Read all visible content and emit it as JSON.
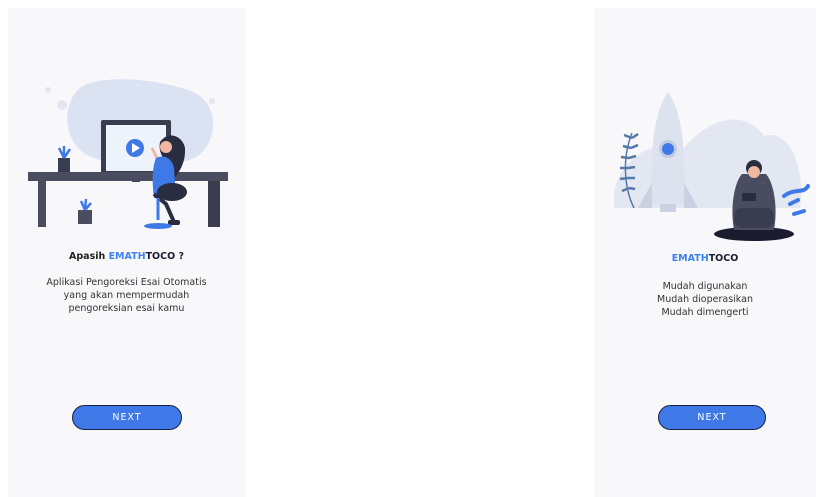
{
  "onboarding_1": {
    "title_prefix": "Apasih",
    "brand_part1": "EMATH",
    "brand_part2": "TOCO",
    "title_suffix": "?",
    "description": [
      "Aplikasi Pengoreksi Esai Otomatis",
      "yang akan mempermudah",
      "pengoreksian esai kamu"
    ],
    "next_label": "NEXT"
  },
  "onboarding_2": {
    "brand_part1": "EMATH",
    "brand_part2": "TOCO",
    "features": [
      "Mudah digunakan",
      "Mudah dioperasikan",
      "Mudah dimengerti"
    ],
    "next_label": "NEXT"
  },
  "colors": {
    "accent": "#3f79e8",
    "button_border": "#1b2145",
    "screen_bg": "#f8f8fa"
  }
}
